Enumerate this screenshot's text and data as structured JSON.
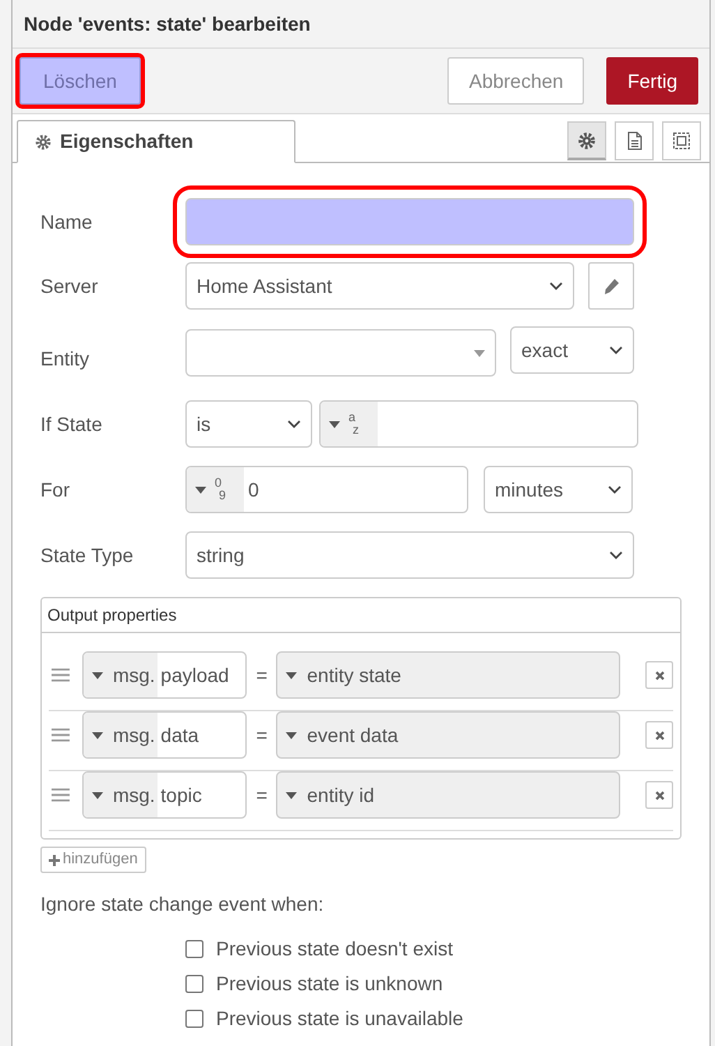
{
  "window": {
    "title": "Node 'events: state' bearbeiten"
  },
  "actions": [
    {
      "label": "Löschen",
      "kind": "delete",
      "highlighted": true
    },
    {
      "label": "Abbrechen",
      "kind": "cancel",
      "highlighted": false
    },
    {
      "label": "Fertig",
      "kind": "primary",
      "highlighted": false
    }
  ],
  "tabs": [
    {
      "label": "Eigenschaften",
      "selected": true
    }
  ],
  "tab_tools": [
    {
      "kind": "gear",
      "selected": true
    },
    {
      "kind": "document",
      "selected": false
    },
    {
      "kind": "frame",
      "selected": false
    }
  ],
  "form": {
    "name": {
      "label": "Name",
      "highlighted": true
    },
    "server": {
      "label": "Server",
      "value": "Home Assistant"
    },
    "entity": {
      "label": "Entity",
      "match": "exact"
    },
    "if_state": {
      "label": "If State",
      "operator": "is",
      "type_glyph": "a",
      "type_glyph_sub": "z"
    },
    "for": {
      "label": "For",
      "type_glyph": "0",
      "type_glyph_sub": "9",
      "value": "0",
      "unit": "minutes"
    },
    "state_type": {
      "label": "State Type",
      "value": "string"
    }
  },
  "output_properties": {
    "title": "Output properties",
    "rows": [
      {
        "prefix": "msg.",
        "property": "payload",
        "equals": "=",
        "value": "entity state"
      },
      {
        "prefix": "msg.",
        "property": "data",
        "equals": "=",
        "value": "event data"
      },
      {
        "prefix": "msg.",
        "property": "topic",
        "equals": "=",
        "value": "entity id"
      }
    ],
    "add_button": "hinzufügen"
  },
  "ignore": {
    "title": "Ignore state change event when:",
    "options": [
      {
        "label": "Previous state doesn't exist",
        "checked": false
      },
      {
        "label": "Previous state is unknown",
        "checked": false
      },
      {
        "label": "Previous state is unavailable",
        "checked": false
      }
    ]
  }
}
